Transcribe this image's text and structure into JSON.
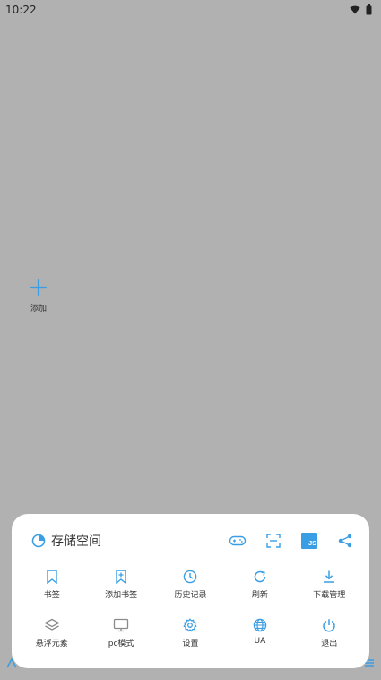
{
  "status": {
    "time": "10:22"
  },
  "home": {
    "add_label": "添加"
  },
  "menu": {
    "storage_label": "存储空间",
    "grid": [
      {
        "label": "书签",
        "icon": "bookmark-icon"
      },
      {
        "label": "添加书签",
        "icon": "add-bookmark-icon"
      },
      {
        "label": "历史记录",
        "icon": "history-clock-icon"
      },
      {
        "label": "刷新",
        "icon": "refresh-icon"
      },
      {
        "label": "下载管理",
        "icon": "download-icon"
      },
      {
        "label": "悬浮元素",
        "icon": "layers-icon"
      },
      {
        "label": "pc模式",
        "icon": "monitor-icon"
      },
      {
        "label": "设置",
        "icon": "gear-icon"
      },
      {
        "label": "UA",
        "icon": "globe-icon"
      },
      {
        "label": "退出",
        "icon": "power-icon"
      }
    ],
    "header_icons": [
      "gamepad-icon",
      "scan-icon",
      "js-icon",
      "share-icon"
    ],
    "js_text": "JS"
  },
  "colors": {
    "accent": "#3a9ee4",
    "gray_icon": "#8a8a8a",
    "backdrop": "#b1b1b1"
  }
}
